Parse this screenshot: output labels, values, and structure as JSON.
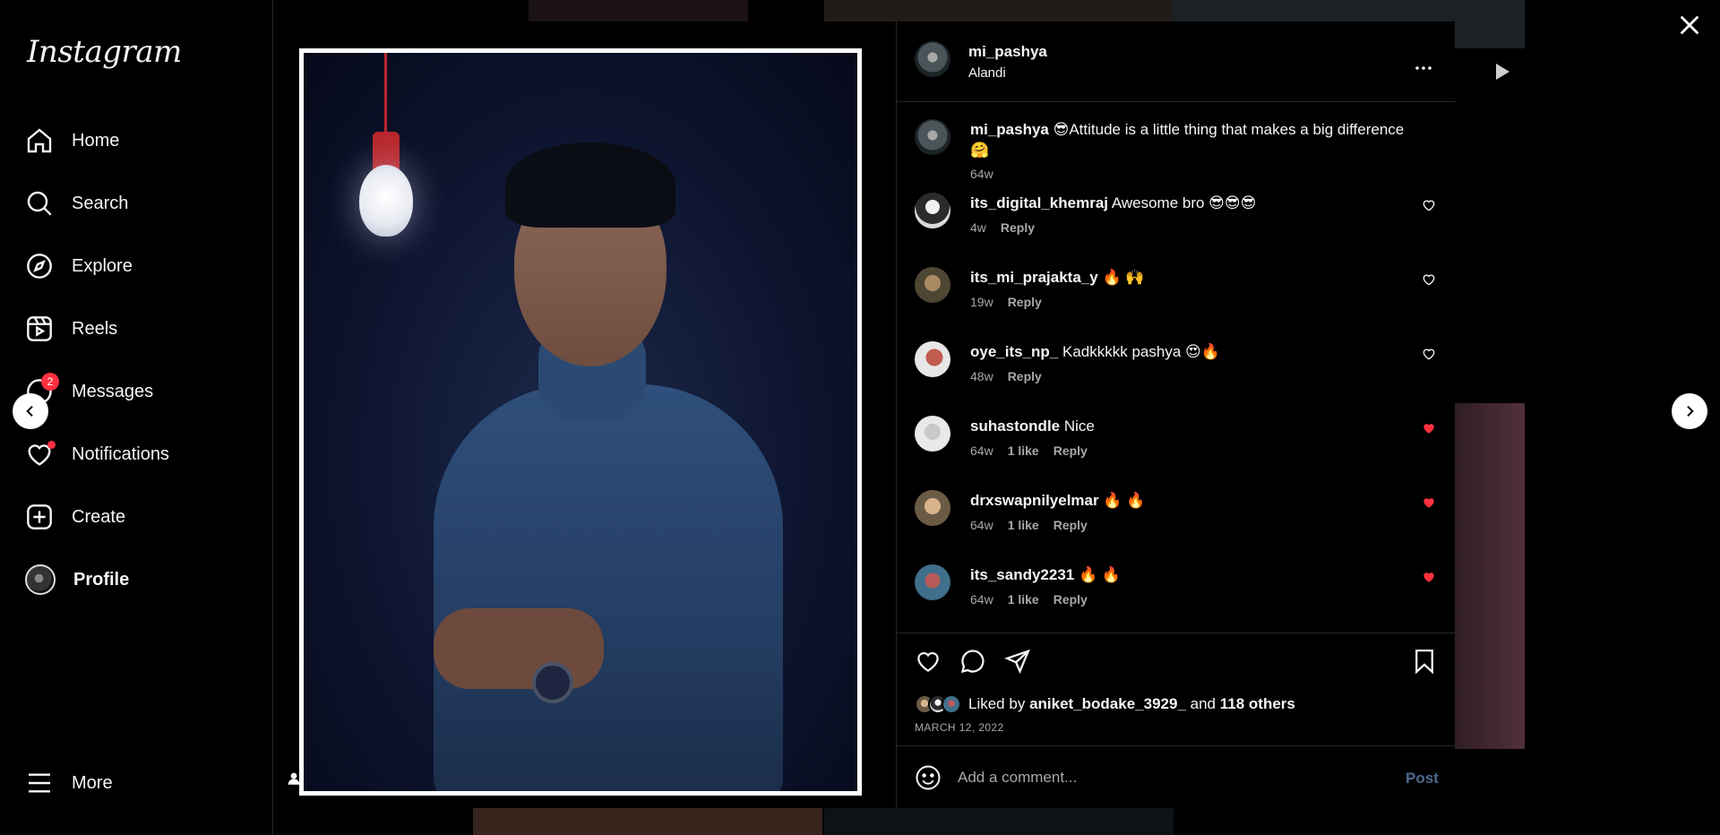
{
  "app": {
    "logo": "Instagram"
  },
  "sidebar": {
    "items": [
      {
        "label": "Home",
        "icon": "home-icon"
      },
      {
        "label": "Search",
        "icon": "search-icon"
      },
      {
        "label": "Explore",
        "icon": "explore-icon"
      },
      {
        "label": "Reels",
        "icon": "reels-icon"
      },
      {
        "label": "Messages",
        "icon": "messages-icon",
        "badge": "2"
      },
      {
        "label": "Notifications",
        "icon": "heart-icon"
      },
      {
        "label": "Create",
        "icon": "plus-icon"
      },
      {
        "label": "Profile",
        "icon": "avatar"
      }
    ],
    "more": "More"
  },
  "post": {
    "username": "mi_pashya",
    "location": "Alandi",
    "caption": {
      "username": "mi_pashya",
      "text": "😎Attitude is a little thing that makes a big difference 🤗",
      "age": "64w"
    },
    "comments": [
      {
        "username": "its_digital_khemraj",
        "text": "Awesome bro 😎😎😎",
        "age": "4w",
        "likes": "",
        "reply": "Reply",
        "liked": false
      },
      {
        "username": "its_mi_prajakta_y",
        "text": "🔥 🙌",
        "age": "19w",
        "likes": "",
        "reply": "Reply",
        "liked": false
      },
      {
        "username": "oye_its_np_",
        "text": "Kadkkkkk pashya 😍🔥",
        "age": "48w",
        "likes": "",
        "reply": "Reply",
        "liked": false
      },
      {
        "username": "suhastondle",
        "text": "Nice",
        "age": "64w",
        "likes": "1 like",
        "reply": "Reply",
        "liked": true
      },
      {
        "username": "drxswapnilyelmar",
        "text": "🔥 🔥",
        "age": "64w",
        "likes": "1 like",
        "reply": "Reply",
        "liked": true
      },
      {
        "username": "its_sandy2231",
        "text": "🔥 🔥",
        "age": "64w",
        "likes": "1 like",
        "reply": "Reply",
        "liked": true
      }
    ],
    "liked_by": {
      "prefix": "Liked by",
      "user": "aniket_bodake_3929_",
      "middle": "and",
      "others": "118 others"
    },
    "date": "MARCH 12, 2022",
    "add_comment": {
      "placeholder": "Add a comment...",
      "post_label": "Post"
    }
  },
  "colors": {
    "like_red": "#ff3040",
    "post_blue": "#4d6a8f",
    "muted": "#a8a8a8"
  }
}
